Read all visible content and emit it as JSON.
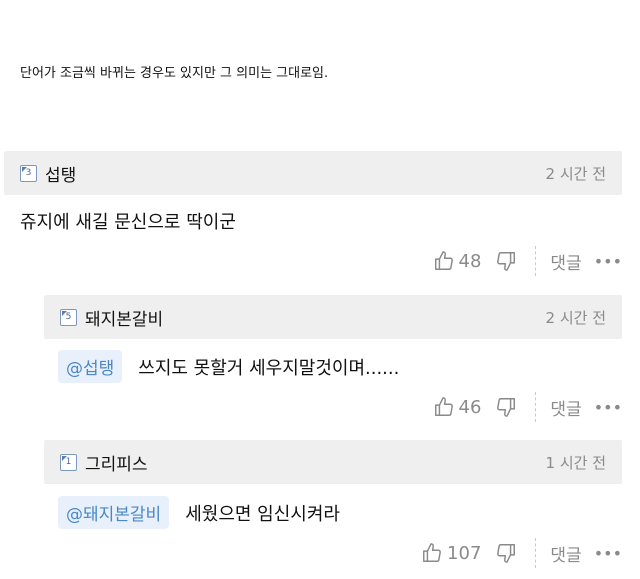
{
  "intro_text": "단어가 조금씩 바뀌는 경우도 있지만 그 의미는 그대로임.",
  "comments": [
    {
      "level": "3",
      "nickname": "섭탱",
      "time": "2 시간 전",
      "mention": "",
      "text": "쥬지에 새길 문신으로 딱이군",
      "likes": "48",
      "reply_label": "댓글"
    },
    {
      "level": "5",
      "nickname": "돼지본갈비",
      "time": "2 시간 전",
      "mention": "@섭탱",
      "text": "쓰지도 못할거 세우지말것이며......",
      "likes": "46",
      "reply_label": "댓글"
    },
    {
      "level": "1",
      "nickname": "그리피스",
      "time": "1 시간 전",
      "mention": "@돼지본갈비",
      "text": "세웠으면 임신시켜라",
      "likes": "107",
      "reply_label": "댓글"
    }
  ],
  "icons": {
    "like": "thumbs-up-icon",
    "dislike": "thumbs-down-icon",
    "more": "more-dots-icon"
  }
}
